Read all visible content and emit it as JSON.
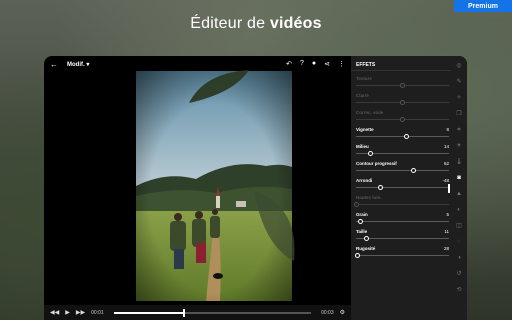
{
  "headline": {
    "part1": "Éditeur de ",
    "part2": "vidéos"
  },
  "premium_label": "Premium",
  "topbar": {
    "back_icon": "arrow-left-icon",
    "mode_label": "Modif. ▾"
  },
  "panel": {
    "title": "EFFETS",
    "sliders": [
      {
        "label": "Texture",
        "value": "",
        "pos": 0.5,
        "enabled": false
      },
      {
        "label": "Clarté",
        "value": "",
        "pos": 0.5,
        "enabled": false
      },
      {
        "label": "Correc. voile",
        "value": "",
        "pos": 0.5,
        "enabled": false
      },
      {
        "label": "Vignette",
        "value": "8",
        "pos": 0.54,
        "enabled": true
      },
      {
        "label": "Milieu",
        "value": "14",
        "pos": 0.16,
        "enabled": true
      },
      {
        "label": "Contour progressif",
        "value": "62",
        "pos": 0.62,
        "enabled": true
      },
      {
        "label": "Arrondi",
        "value": "-48",
        "pos": 0.26,
        "enabled": true
      },
      {
        "label": "Hautes lum.",
        "value": "",
        "pos": 0.0,
        "enabled": false
      },
      {
        "label": "Grain",
        "value": "5",
        "pos": 0.05,
        "enabled": true
      },
      {
        "label": "Taille",
        "value": "11",
        "pos": 0.11,
        "enabled": true
      },
      {
        "label": "Rugosité",
        "value": "28",
        "pos": 0.02,
        "enabled": true
      }
    ]
  },
  "playback": {
    "start_time": "00:01",
    "end_time": "00:03",
    "progress": 0.35
  }
}
